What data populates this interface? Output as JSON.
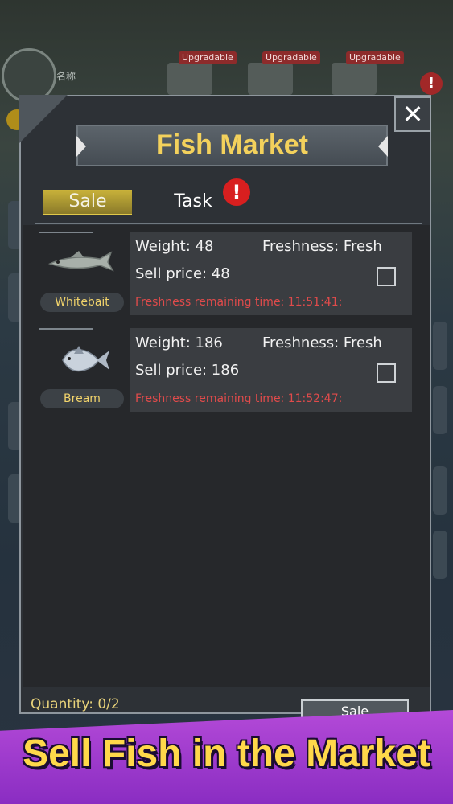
{
  "background": {
    "player_name": "名称",
    "upgrade_tags": [
      "Upgradable",
      "Upgradable",
      "Upgradable"
    ],
    "alert_icon": "exclamation-icon"
  },
  "dialog": {
    "title": "Fish Market",
    "close_icon": "close-icon",
    "tabs": [
      {
        "label": "Sale",
        "active": true
      },
      {
        "label": "Task",
        "active": false,
        "alert": "!"
      }
    ],
    "fish": [
      {
        "name": "Whitebait",
        "weight_label": "Weight: 48",
        "freshness_label": "Freshness: Fresh",
        "price_label": "Sell price: 48",
        "timer_label": "Freshness remaining time: 11:51:41:",
        "checked": false,
        "icon": "whitebait-fish-icon"
      },
      {
        "name": "Bream",
        "weight_label": "Weight: 186",
        "freshness_label": "Freshness: Fresh",
        "price_label": "Sell price: 186",
        "timer_label": "Freshness remaining time: 11:52:47:",
        "checked": false,
        "icon": "bream-fish-icon"
      }
    ],
    "quantity": "Quantity: 0/2",
    "sell_label": "Sale"
  },
  "banner": {
    "text": "Sell Fish in the Market"
  },
  "colors": {
    "title": "#f3d15c",
    "timer": "#e04b4b",
    "banner_bg": "#a63fd0",
    "banner_text": "#ffd84a"
  }
}
